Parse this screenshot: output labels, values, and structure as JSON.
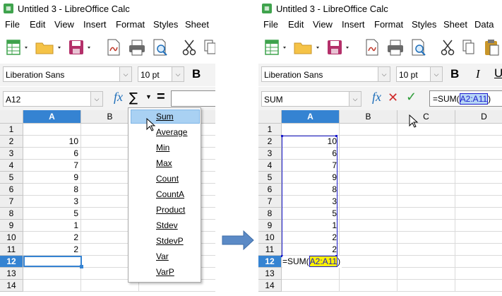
{
  "left_window": {
    "title": "Untitled 3 - LibreOffice Calc",
    "app_icon": "calc-icon",
    "menu": [
      "File",
      "Edit",
      "View",
      "Insert",
      "Format",
      "Styles",
      "Sheet"
    ],
    "font_name": "Liberation Sans",
    "font_size": "10 pt",
    "bold_label": "B",
    "name_box": "A12",
    "fx_label": "fx",
    "sigma": "∑",
    "equals": "=",
    "formula": "",
    "columns": [
      "A",
      "B"
    ],
    "rows": [
      "1",
      "2",
      "3",
      "4",
      "5",
      "6",
      "7",
      "8",
      "9",
      "10",
      "11",
      "12",
      "13",
      "14"
    ],
    "values": [
      "",
      "10",
      "6",
      "7",
      "9",
      "8",
      "3",
      "5",
      "1",
      "2",
      "2",
      "",
      "",
      ""
    ],
    "selected_row": "12",
    "functions_menu": [
      "Sum",
      "Average",
      "Min",
      "Max",
      "Count",
      "CountA",
      "Product",
      "Stdev",
      "StdevP",
      "Var",
      "VarP"
    ],
    "highlighted_function": "Sum"
  },
  "right_window": {
    "title": "Untitled 3 - LibreOffice Calc",
    "app_icon": "calc-icon",
    "menu": [
      "File",
      "Edit",
      "View",
      "Insert",
      "Format",
      "Styles",
      "Sheet",
      "Data"
    ],
    "font_name": "Liberation Sans",
    "font_size": "10 pt",
    "bold_label": "B",
    "italic_label": "I",
    "underline_label": "U",
    "name_box": "SUM",
    "fx_label": "fx",
    "cancel_glyph": "✕",
    "accept_glyph": "✓",
    "formula_prefix": "=SUM(",
    "formula_range": "A2:A11",
    "formula_suffix": ")",
    "columns": [
      "A",
      "B",
      "C",
      "D"
    ],
    "rows": [
      "1",
      "2",
      "3",
      "4",
      "5",
      "6",
      "7",
      "8",
      "9",
      "10",
      "11",
      "12",
      "13",
      "14"
    ],
    "values": [
      "",
      "10",
      "6",
      "7",
      "9",
      "8",
      "3",
      "5",
      "1",
      "2",
      "2",
      "",
      "",
      ""
    ],
    "selected_row": "12",
    "cell_formula_prefix": "=SUM(",
    "cell_formula_range": "A2:A11",
    "cell_formula_suffix": ")"
  },
  "colors": {
    "accent": "#3583d2",
    "header_bg": "#eeeeee",
    "menu_highlight": "#a9d1f3",
    "range_highlight": "#fff200",
    "range_border": "#1a1acc",
    "arrow": "#5b8ac6"
  }
}
